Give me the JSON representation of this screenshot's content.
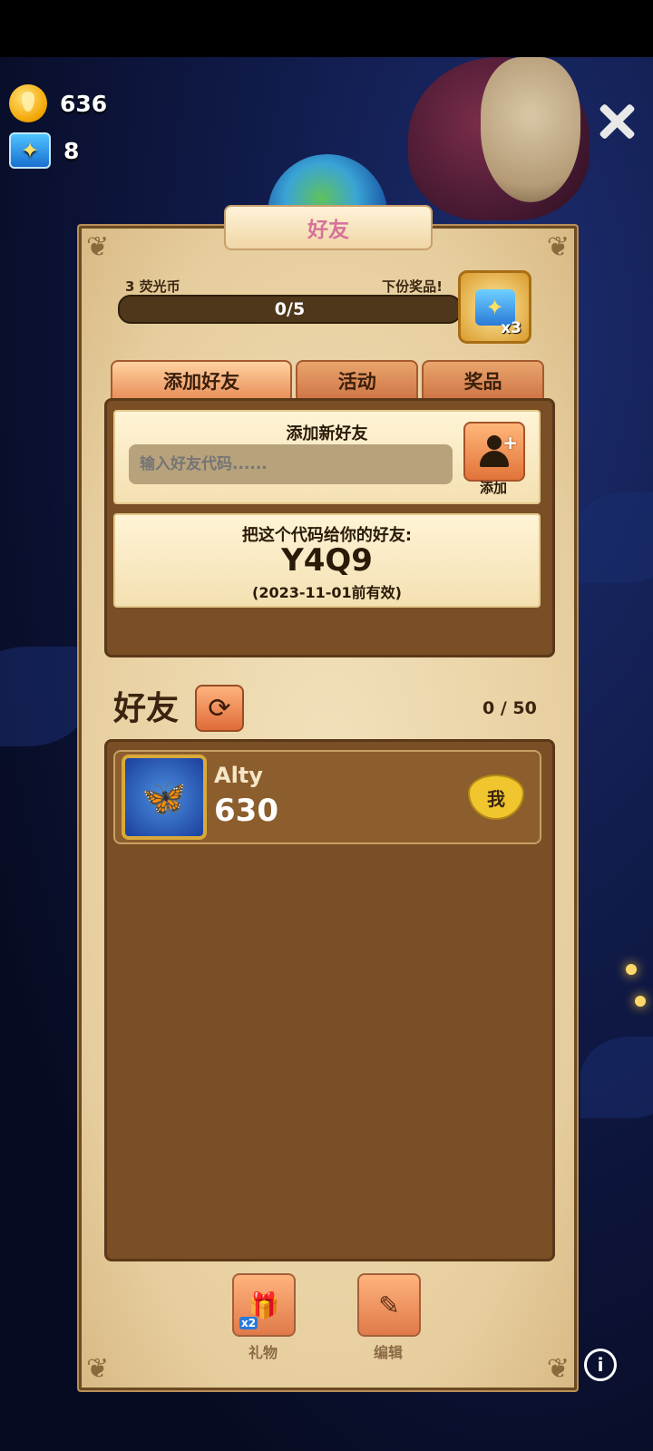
{
  "hud": {
    "coins": "636",
    "butterflies": "8"
  },
  "title": "好友",
  "progress": {
    "reward_currency_label": "3 荧光币",
    "next_reward_label": "下份奖品!",
    "value": "0/5",
    "reward_multiplier": "x3"
  },
  "tabs": [
    {
      "label": "添加好友"
    },
    {
      "label": "活动"
    },
    {
      "label": "奖品"
    }
  ],
  "add_friend": {
    "title": "添加新好友",
    "placeholder": "输入好友代码......",
    "button_label": "添加"
  },
  "share_code": {
    "prompt": "把这个代码给你的好友:",
    "code": "Y4Q9",
    "validity": "(2023-11-01前有效)"
  },
  "friends": {
    "title": "好友",
    "count": "0 / 50",
    "items": [
      {
        "name": "Alty",
        "score": "630",
        "badge": "我"
      }
    ]
  },
  "bottom": {
    "gift_label": "礼物",
    "gift_badge": "x2",
    "edit_label": "编辑"
  }
}
